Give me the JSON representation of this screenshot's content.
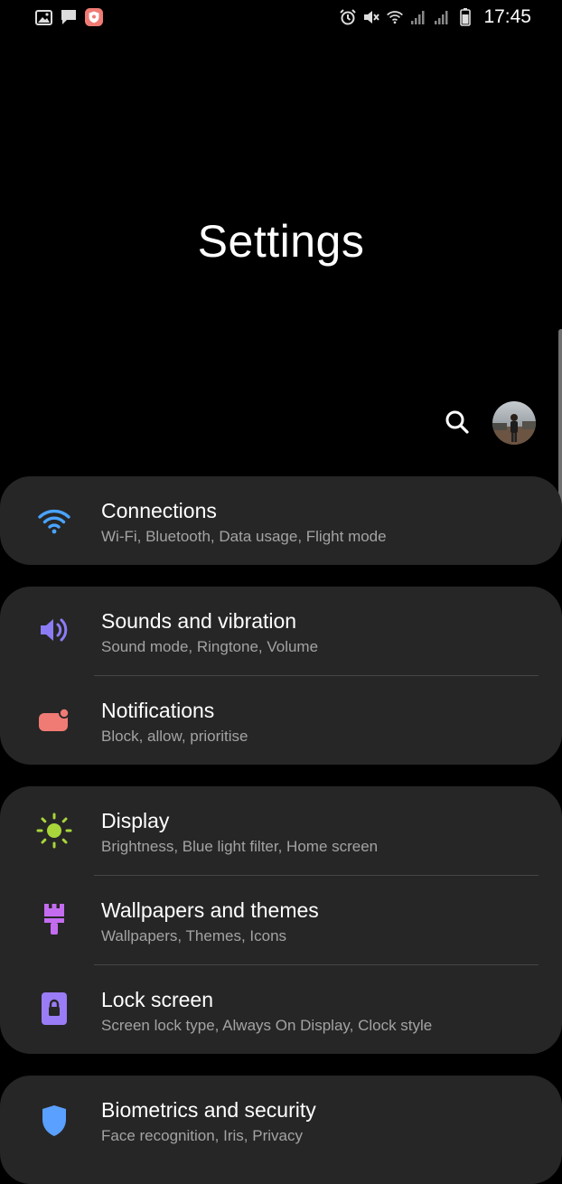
{
  "status_bar": {
    "time": "17:45",
    "left_icons": [
      "gallery-icon",
      "message-icon",
      "shield-app-icon"
    ],
    "right_icons": [
      "alarm-icon",
      "mute-icon",
      "wifi-icon",
      "signal-icon",
      "signal-icon-2",
      "battery-icon"
    ]
  },
  "header": {
    "title": "Settings"
  },
  "colors": {
    "connections": "#4aa3ff",
    "sounds": "#8b7cf6",
    "notifications": "#f07b74",
    "display": "#a8d63a",
    "wallpapers": "#c46cf0",
    "lock_screen": "#9a7cf6",
    "biometrics": "#5aa0ff"
  },
  "items": [
    {
      "title": "Connections",
      "subtitle": "Wi-Fi, Bluetooth, Data usage, Flight mode",
      "icon": "wifi-icon"
    },
    {
      "title": "Sounds and vibration",
      "subtitle": "Sound mode, Ringtone, Volume",
      "icon": "volume-icon"
    },
    {
      "title": "Notifications",
      "subtitle": "Block, allow, prioritise",
      "icon": "notification-icon"
    },
    {
      "title": "Display",
      "subtitle": "Brightness, Blue light filter, Home screen",
      "icon": "brightness-icon"
    },
    {
      "title": "Wallpapers and themes",
      "subtitle": "Wallpapers, Themes, Icons",
      "icon": "paintbrush-icon"
    },
    {
      "title": "Lock screen",
      "subtitle": "Screen lock type, Always On Display, Clock style",
      "icon": "lock-icon"
    },
    {
      "title": "Biometrics and security",
      "subtitle": "Face recognition, Iris, Privacy",
      "icon": "shield-icon"
    }
  ]
}
